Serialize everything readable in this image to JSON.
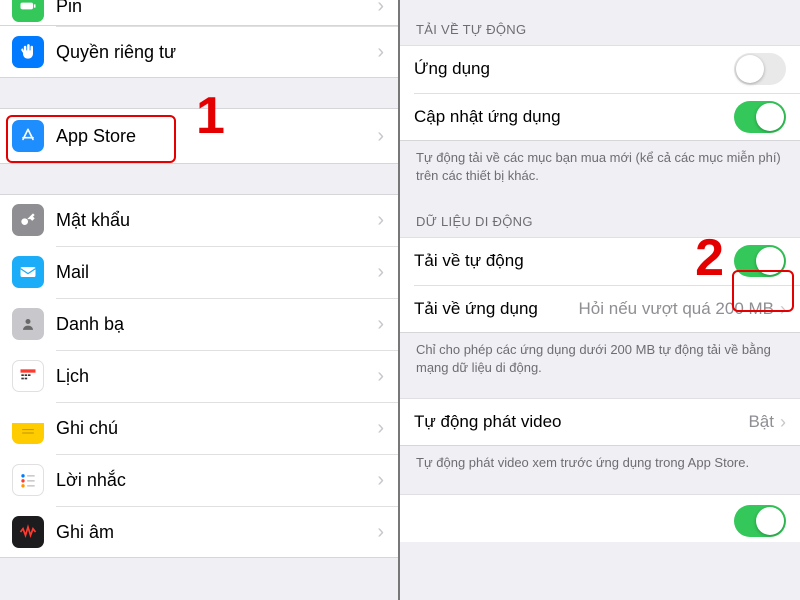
{
  "left": {
    "items": [
      {
        "key": "pin",
        "label": "Pin"
      },
      {
        "key": "privacy",
        "label": "Quyền riêng tư"
      },
      {
        "key": "appstore",
        "label": "App Store"
      },
      {
        "key": "passwords",
        "label": "Mật khẩu"
      },
      {
        "key": "mail",
        "label": "Mail"
      },
      {
        "key": "contacts",
        "label": "Danh bạ"
      },
      {
        "key": "calendar",
        "label": "Lịch"
      },
      {
        "key": "notes",
        "label": "Ghi chú"
      },
      {
        "key": "reminders",
        "label": "Lời nhắc"
      },
      {
        "key": "voicememos",
        "label": "Ghi âm"
      }
    ]
  },
  "right": {
    "section1_header": "TẢI VỀ TỰ ĐỘNG",
    "apps_label": "Ứng dụng",
    "updates_label": "Cập nhật ứng dụng",
    "section1_footer": "Tự động tải về các mục bạn mua mới (kể cả các mục miễn phí) trên các thiết bị khác.",
    "section2_header": "DỮ LIỆU DI ĐỘNG",
    "auto_dl_label": "Tải về tự động",
    "app_dl_label": "Tải về ứng dụng",
    "app_dl_value": "Hỏi nếu vượt quá 200 MB",
    "section2_footer": "Chỉ cho phép các ứng dụng dưới 200 MB tự động tải về bằng mạng dữ liệu di động.",
    "video_label": "Tự động phát video",
    "video_value": "Bật",
    "video_footer": "Tự động phát video xem trước ứng dụng trong App Store."
  },
  "annotations": {
    "one": "1",
    "two": "2"
  },
  "colors": {
    "accent_green": "#34c759",
    "annotation_red": "#e40000"
  }
}
